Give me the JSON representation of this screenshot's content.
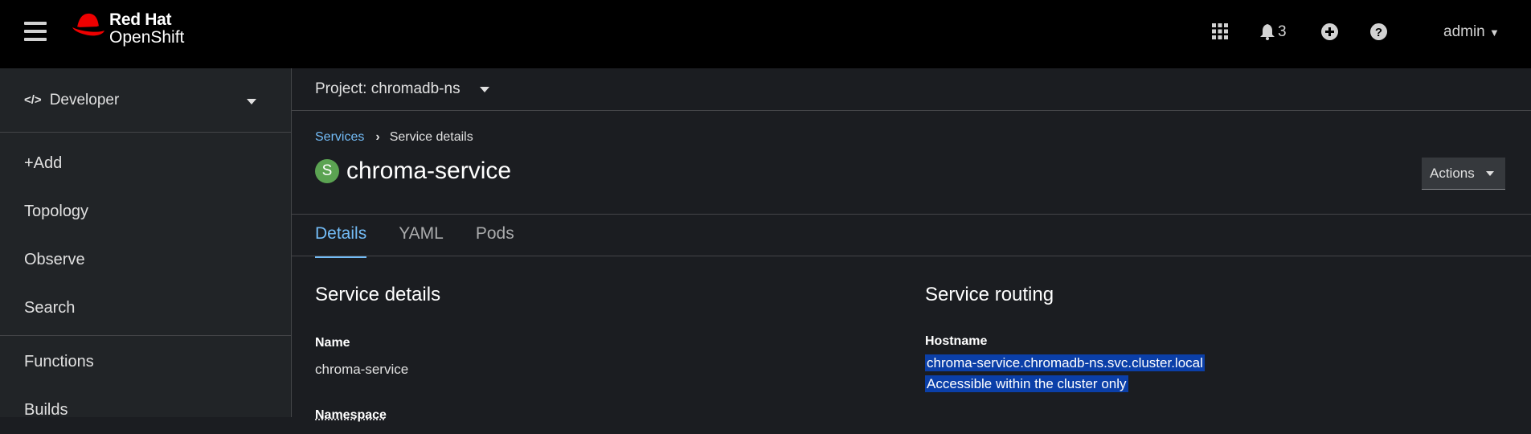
{
  "header": {
    "brand_line1": "Red Hat",
    "brand_line2": "OpenShift",
    "notification_count": "3",
    "user": "admin"
  },
  "sidebar": {
    "perspective": "Developer",
    "items": [
      {
        "label": "+Add"
      },
      {
        "label": "Topology"
      },
      {
        "label": "Observe"
      },
      {
        "label": "Search"
      },
      {
        "label": "Functions"
      },
      {
        "label": "Builds"
      }
    ]
  },
  "project": {
    "label": "Project: chromadb-ns"
  },
  "breadcrumb": {
    "parent": "Services",
    "current": "Service details"
  },
  "page": {
    "badge": "S",
    "title": "chroma-service",
    "actions_label": "Actions"
  },
  "tabs": [
    {
      "label": "Details"
    },
    {
      "label": "YAML"
    },
    {
      "label": "Pods"
    }
  ],
  "details": {
    "title": "Service details",
    "name_label": "Name",
    "name_value": "chroma-service",
    "namespace_label": "Namespace"
  },
  "routing": {
    "title": "Service routing",
    "hostname_label": "Hostname",
    "hostname_value": "chroma-service.chromadb-ns.svc.cluster.local",
    "hostname_note": "Accessible within the cluster only"
  },
  "colors": {
    "link": "#73bcf7",
    "badge": "#5ba352",
    "highlight": "#0b3fa8",
    "brand_red": "#ee0000"
  }
}
